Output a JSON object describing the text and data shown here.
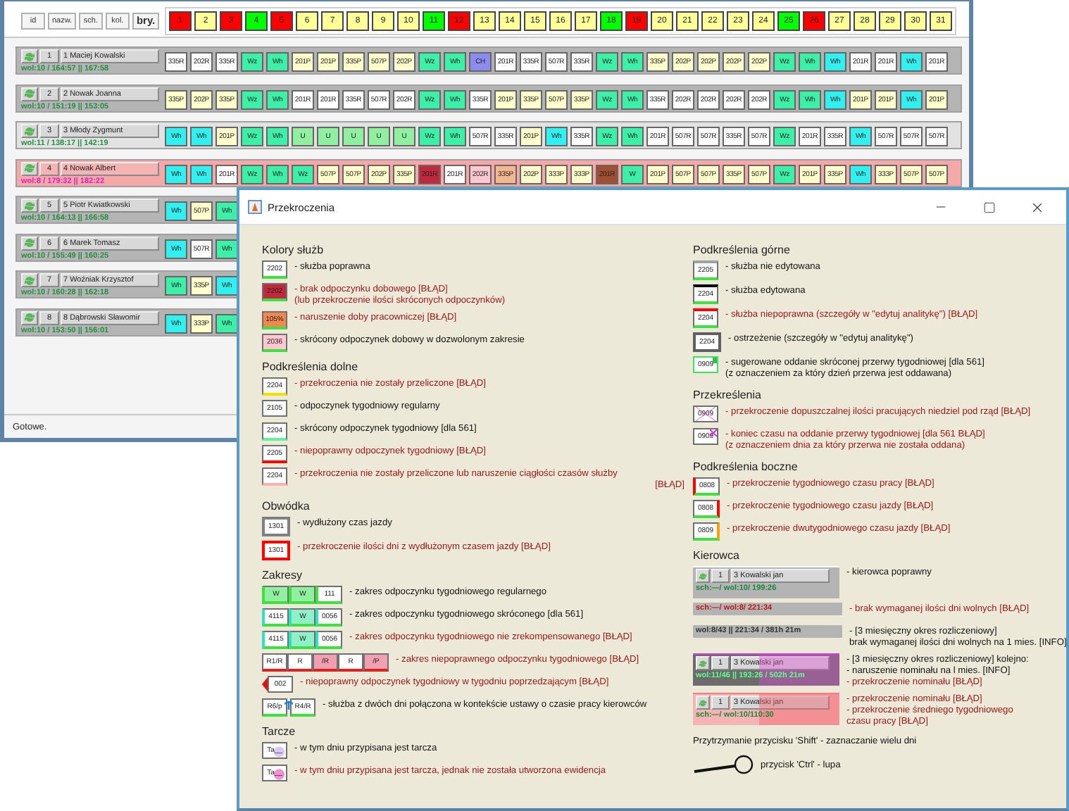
{
  "main_window": {
    "sort_buttons": [
      "id",
      "nazw.",
      "sch.",
      "kol.",
      "bry."
    ],
    "days": [
      {
        "label": "1",
        "color": "#ff0000"
      },
      {
        "label": "2",
        "color": "#ffff99"
      },
      {
        "label": "3",
        "color": "#ff0000"
      },
      {
        "label": "4",
        "color": "#00ff00"
      },
      {
        "label": "5",
        "color": "#ff0000"
      },
      {
        "label": "6",
        "color": "#ffff99"
      },
      {
        "label": "7",
        "color": "#ffff99"
      },
      {
        "label": "8",
        "color": "#ffff99"
      },
      {
        "label": "9",
        "color": "#ffff99"
      },
      {
        "label": "10",
        "color": "#ffff99"
      },
      {
        "label": "11",
        "color": "#00ff00"
      },
      {
        "label": "12",
        "color": "#ff0000"
      },
      {
        "label": "13",
        "color": "#ffff99"
      },
      {
        "label": "14",
        "color": "#ffff99"
      },
      {
        "label": "15",
        "color": "#ffff99"
      },
      {
        "label": "16",
        "color": "#ffff99"
      },
      {
        "label": "17",
        "color": "#ffff99"
      },
      {
        "label": "18",
        "color": "#00ff00"
      },
      {
        "label": "19",
        "color": "#ff0000"
      },
      {
        "label": "20",
        "color": "#ffff99"
      },
      {
        "label": "21",
        "color": "#ffff99"
      },
      {
        "label": "22",
        "color": "#ffff99"
      },
      {
        "label": "23",
        "color": "#ffff99"
      },
      {
        "label": "24",
        "color": "#ffff99"
      },
      {
        "label": "25",
        "color": "#00ff00"
      },
      {
        "label": "26",
        "color": "#ff0000"
      },
      {
        "label": "27",
        "color": "#ffff99"
      },
      {
        "label": "28",
        "color": "#ffff99"
      },
      {
        "label": "29",
        "color": "#ffff99"
      },
      {
        "label": "30",
        "color": "#ffff99"
      },
      {
        "label": "31",
        "color": "#ffff99"
      }
    ],
    "rows": [
      {
        "kind": "normal",
        "number": "1",
        "name": "1 Maciej Kowalski",
        "stats": "wol:10 / 164:57 || 167:58",
        "cells": [
          {
            "code": "335R",
            "color": "#ffffff"
          },
          {
            "code": "202R",
            "color": "#ffffff"
          },
          {
            "code": "335R",
            "color": "#ffffff"
          },
          {
            "code": "Wz",
            "color": "#3cf0a8"
          },
          {
            "code": "Wh",
            "color": "#3cf0a8"
          },
          {
            "code": "201P",
            "color": "#ffffcc"
          },
          {
            "code": "201P",
            "color": "#ffffcc"
          },
          {
            "code": "335P",
            "color": "#ffffcc"
          },
          {
            "code": "507P",
            "color": "#ffffcc"
          },
          {
            "code": "202P",
            "color": "#ffffcc"
          },
          {
            "code": "Wz",
            "color": "#3cf0a8"
          },
          {
            "code": "Wh",
            "color": "#3cf0a8"
          },
          {
            "code": "CH",
            "color": "#8c8cf0"
          },
          {
            "code": "201R",
            "color": "#ffffff"
          },
          {
            "code": "335R",
            "color": "#ffffff"
          },
          {
            "code": "507R",
            "color": "#ffffff"
          },
          {
            "code": "335R",
            "color": "#ffffff"
          },
          {
            "code": "Wz",
            "color": "#3cf0a8"
          },
          {
            "code": "Wh",
            "color": "#3cf0a8"
          },
          {
            "code": "335P",
            "color": "#ffffcc"
          },
          {
            "code": "202P",
            "color": "#ffffcc"
          },
          {
            "code": "202P",
            "color": "#ffffcc"
          },
          {
            "code": "202P",
            "color": "#ffffcc"
          },
          {
            "code": "202P",
            "color": "#ffffcc"
          },
          {
            "code": "Wz",
            "color": "#3cf0a8"
          },
          {
            "code": "Wh",
            "color": "#3cf0a8"
          },
          {
            "code": "Wh",
            "color": "#30f0f0"
          },
          {
            "code": "201R",
            "color": "#ffffff"
          },
          {
            "code": "201R",
            "color": "#ffffff"
          },
          {
            "code": "Wh",
            "color": "#30f0f0"
          },
          {
            "code": "201R",
            "color": "#ffffff"
          }
        ]
      },
      {
        "kind": "normal",
        "number": "2",
        "name": "2 Nowak Joanna",
        "stats": "wol:10 / 151:19 || 153:05",
        "cells": [
          {
            "code": "335P",
            "color": "#ffffcc"
          },
          {
            "code": "202P",
            "color": "#ffffcc"
          },
          {
            "code": "335P",
            "color": "#ffffcc"
          },
          {
            "code": "Wz",
            "color": "#3cf0a8"
          },
          {
            "code": "Wh",
            "color": "#3cf0a8"
          },
          {
            "code": "201R",
            "color": "#ffffff"
          },
          {
            "code": "201R",
            "color": "#ffffff"
          },
          {
            "code": "335R",
            "color": "#ffffff"
          },
          {
            "code": "507R",
            "color": "#ffffff"
          },
          {
            "code": "202R",
            "color": "#ffffff"
          },
          {
            "code": "Wz",
            "color": "#3cf0a8"
          },
          {
            "code": "Wh",
            "color": "#3cf0a8"
          },
          {
            "code": "335R",
            "color": "#ffffff"
          },
          {
            "code": "201P",
            "color": "#ffffcc"
          },
          {
            "code": "335P",
            "color": "#ffffcc"
          },
          {
            "code": "507P",
            "color": "#ffffcc"
          },
          {
            "code": "335P",
            "color": "#ffffcc"
          },
          {
            "code": "Wz",
            "color": "#3cf0a8"
          },
          {
            "code": "Wh",
            "color": "#3cf0a8"
          },
          {
            "code": "335R",
            "color": "#ffffff"
          },
          {
            "code": "202R",
            "color": "#ffffff"
          },
          {
            "code": "202R",
            "color": "#ffffff"
          },
          {
            "code": "202R",
            "color": "#ffffff"
          },
          {
            "code": "202R",
            "color": "#ffffff"
          },
          {
            "code": "Wz",
            "color": "#3cf0a8"
          },
          {
            "code": "Wh",
            "color": "#3cf0a8"
          },
          {
            "code": "Wh",
            "color": "#30f0f0"
          },
          {
            "code": "201P",
            "color": "#ffffcc"
          },
          {
            "code": "201P",
            "color": "#ffffcc"
          },
          {
            "code": "Wh",
            "color": "#30f0f0"
          },
          {
            "code": "201P",
            "color": "#ffffcc"
          }
        ]
      },
      {
        "kind": "light",
        "number": "3",
        "name": "3 Młody Zygmunt",
        "stats": "wol:11 / 138:17 || 142:19",
        "cells": [
          {
            "code": "Wh",
            "color": "#30f0f0"
          },
          {
            "code": "Wh",
            "color": "#30f0f0"
          },
          {
            "code": "201P",
            "color": "#ffffcc"
          },
          {
            "code": "Wz",
            "color": "#3cf0a8"
          },
          {
            "code": "Wh",
            "color": "#3cf0a8"
          },
          {
            "code": "U",
            "color": "#90f0a0"
          },
          {
            "code": "U",
            "color": "#90f0a0"
          },
          {
            "code": "U",
            "color": "#90f0a0"
          },
          {
            "code": "U",
            "color": "#90f0a0"
          },
          {
            "code": "U",
            "color": "#90f0a0"
          },
          {
            "code": "Wz",
            "color": "#3cf0a8"
          },
          {
            "code": "Wh",
            "color": "#3cf0a8"
          },
          {
            "code": "507R",
            "color": "#ffffff"
          },
          {
            "code": "335R",
            "color": "#ffffff"
          },
          {
            "code": "201P",
            "color": "#ffffcc"
          },
          {
            "code": "Wh",
            "color": "#30f0f0"
          },
          {
            "code": "335R",
            "color": "#ffffff"
          },
          {
            "code": "Wz",
            "color": "#3cf0a8"
          },
          {
            "code": "Wh",
            "color": "#3cf0a8"
          },
          {
            "code": "201R",
            "color": "#ffffff"
          },
          {
            "code": "507R",
            "color": "#ffffff"
          },
          {
            "code": "507R",
            "color": "#ffffff"
          },
          {
            "code": "335R",
            "color": "#ffffff"
          },
          {
            "code": "507R",
            "color": "#ffffff"
          },
          {
            "code": "Wz",
            "color": "#3cf0a8"
          },
          {
            "code": "201R",
            "color": "#ffffff"
          },
          {
            "code": "335R",
            "color": "#ffffff"
          },
          {
            "code": "Wh",
            "color": "#30f0f0"
          },
          {
            "code": "507R",
            "color": "#ffffff"
          },
          {
            "code": "507R",
            "color": "#ffffff"
          },
          {
            "code": "507R",
            "color": "#ffffff"
          }
        ]
      },
      {
        "kind": "error",
        "number": "4",
        "name": "4 Nowak Albert",
        "stats": "wol:8 / 179:32 || 182:22",
        "cells": [
          {
            "code": "Wh",
            "color": "#30f0f0"
          },
          {
            "code": "Wh",
            "color": "#30f0f0"
          },
          {
            "code": "201R",
            "color": "#ffffff"
          },
          {
            "code": "Wz",
            "color": "#3cf0a8"
          },
          {
            "code": "Wh",
            "color": "#3cf0a8"
          },
          {
            "code": "Wz",
            "color": "#3cf0a8"
          },
          {
            "code": "507P",
            "color": "#ffffcc"
          },
          {
            "code": "507P",
            "color": "#ffffcc"
          },
          {
            "code": "202P",
            "color": "#ffffcc"
          },
          {
            "code": "335P",
            "color": "#ffffcc"
          },
          {
            "code": "201R",
            "color": "#c0283c"
          },
          {
            "code": "201R",
            "color": "#ffffff"
          },
          {
            "code": "202R",
            "color": "#ffc8d0"
          },
          {
            "code": "335P",
            "color": "#f4b890"
          },
          {
            "code": "202P",
            "color": "#ffffcc"
          },
          {
            "code": "333P",
            "color": "#ffffcc"
          },
          {
            "code": "333P",
            "color": "#ffffcc"
          },
          {
            "code": "201R",
            "color": "#a05030"
          },
          {
            "code": "W",
            "color": "#3cf0a8"
          },
          {
            "code": "201P",
            "color": "#ffffcc"
          },
          {
            "code": "507P",
            "color": "#ffffcc"
          },
          {
            "code": "507P",
            "color": "#ffffcc"
          },
          {
            "code": "335P",
            "color": "#ffffcc"
          },
          {
            "code": "507P",
            "color": "#ffffcc"
          },
          {
            "code": "Wz",
            "color": "#3cf0a8"
          },
          {
            "code": "201P",
            "color": "#ffffcc"
          },
          {
            "code": "335P",
            "color": "#ffffcc"
          },
          {
            "code": "Wh",
            "color": "#30f0f0"
          },
          {
            "code": "333P",
            "color": "#ffffcc"
          },
          {
            "code": "507P",
            "color": "#ffffcc"
          },
          {
            "code": "507P",
            "color": "#ffffcc"
          }
        ]
      },
      {
        "kind": "normal",
        "number": "5",
        "name": "5 Piotr Kwiatkowski",
        "stats": "wol:10 / 164:13 || 166:58",
        "cells": [
          {
            "code": "Wh",
            "color": "#30f0f0"
          },
          {
            "code": "507P",
            "color": "#ffffcc"
          },
          {
            "code": "Wh",
            "color": "#3cf0a8"
          }
        ]
      },
      {
        "kind": "normal",
        "number": "6",
        "name": "6 Marek Tomasz",
        "stats": "wol:10 / 155:49 || 160:25",
        "cells": [
          {
            "code": "Wh",
            "color": "#30f0f0"
          },
          {
            "code": "507R",
            "color": "#ffffff"
          },
          {
            "code": "Wh",
            "color": "#3cf0a8"
          }
        ]
      },
      {
        "kind": "normal",
        "number": "7",
        "name": "7 Woźniak Krzysztof",
        "stats": "wol:10 / 160:28 || 162:18",
        "cells": [
          {
            "code": "Wh",
            "color": "#3cf0a8"
          },
          {
            "code": "335P",
            "color": "#ffffcc"
          },
          {
            "code": "Wh",
            "color": "#30f0f0"
          }
        ]
      },
      {
        "kind": "normal",
        "number": "8",
        "name": "8 Dąbrowski Sławomir",
        "stats": "wol:10 / 153:50 || 156:01",
        "cells": [
          {
            "code": "Wh",
            "color": "#30f0f0"
          },
          {
            "code": "333P",
            "color": "#ffffcc"
          },
          {
            "code": "Wh",
            "color": "#3cf0a8"
          }
        ]
      }
    ],
    "status_bar": "Gotowe."
  },
  "dialog": {
    "title": "Przekroczenia",
    "columns": [
      [
        {
          "heading": "Kolory służb",
          "items": [
            {
              "sample": {
                "kind": "ok",
                "cells": [
                  {
                    "code": "2202",
                    "color": "#ffffff"
                  }
                ]
              },
              "lines": [
                {
                  "text": "- służba poprawna",
                  "error": false
                }
              ]
            },
            {
              "sample": {
                "kind": "ok",
                "cells": [
                  {
                    "code": "2202",
                    "color": "#c0283c"
                  }
                ]
              },
              "lines": [
                {
                  "text": "- brak odpoczynku dobowego [BŁĄD]",
                  "error": true
                },
                {
                  "text": "(lub przekroczenie ilości skróconych odpoczynków)",
                  "error": true
                }
              ]
            },
            {
              "sample": {
                "kind": "ok",
                "cells": [
                  {
                    "code": "105%",
                    "color": "#f08850"
                  }
                ]
              },
              "lines": [
                {
                  "text": "- naruszenie doby pracowniczej [BŁĄD]",
                  "error": true
                }
              ]
            },
            {
              "sample": {
                "kind": "ok",
                "cells": [
                  {
                    "code": "2036",
                    "color": "#ffc8d0"
                  }
                ]
              },
              "lines": [
                {
                  "text": "- skrócony odpoczynek dobowy w dozwolonym zakresie",
                  "error": false
                }
              ]
            }
          ]
        },
        {
          "heading": "Podkreślenia dolne",
          "items": [
            {
              "sample": {
                "kind": "under-yellow",
                "cells": [
                  {
                    "code": "2204",
                    "color": "#ffffff"
                  }
                ]
              },
              "lines": [
                {
                  "text": "- przekroczenia nie zostały przeliczone [BŁĄD]",
                  "error": true
                }
              ]
            },
            {
              "sample": {
                "kind": "under-none",
                "cells": [
                  {
                    "code": "2105",
                    "color": "#ffffff"
                  }
                ]
              },
              "lines": [
                {
                  "text": "- odpoczynek tygodniowy regularny",
                  "error": false
                }
              ]
            },
            {
              "sample": {
                "kind": "under-green",
                "cells": [
                  {
                    "code": "2204",
                    "color": "#ffffff"
                  }
                ]
              },
              "lines": [
                {
                  "text": "- skrócony odpoczynek tygodniowy [dla 561]",
                  "error": false
                }
              ]
            },
            {
              "sample": {
                "kind": "under-red",
                "cells": [
                  {
                    "code": "2205",
                    "color": "#ffffff"
                  }
                ]
              },
              "lines": [
                {
                  "text": "- niepoprawny odpoczynek tygodniowy [BŁĄD]",
                  "error": true
                }
              ]
            },
            {
              "sample": {
                "kind": "under-pink",
                "cells": [
                  {
                    "code": "2204",
                    "color": "#ffffff"
                  }
                ]
              },
              "lines": [
                {
                  "text": "- przekroczenia nie zostały przeliczone lub naruszenie ciągłości czasów służby",
                  "error": true
                },
                {
                  "text": "[BŁĄD]",
                  "error": true,
                  "align_right": true
                }
              ]
            }
          ]
        },
        {
          "heading": "Obwódka",
          "items": [
            {
              "sample": {
                "kind": "frame-gray",
                "cells": [
                  {
                    "code": "1301",
                    "color": "#ffffff"
                  }
                ]
              },
              "lines": [
                {
                  "text": "- wydłużony czas jazdy",
                  "error": false
                }
              ]
            },
            {
              "sample": {
                "kind": "frame-red",
                "cells": [
                  {
                    "code": "1301",
                    "color": "#ffffff"
                  }
                ]
              },
              "lines": [
                {
                  "text": "- przekroczenie ilości dni z wydłużonym czasem jazdy [BŁĄD]",
                  "error": true
                }
              ]
            }
          ]
        },
        {
          "heading": "Zakresy",
          "items": [
            {
              "sample": {
                "kind": "range",
                "cells": [
                  {
                    "code": "W",
                    "color": "#90f0a0"
                  },
                  {
                    "code": "W",
                    "color": "#90f0a0"
                  },
                  {
                    "code": "111",
                    "color": "#ffffff"
                  }
                ]
              },
              "lines": [
                {
                  "text": "- zakres odpoczynku tygodniowego regularnego",
                  "error": false
                }
              ]
            },
            {
              "sample": {
                "kind": "range-short",
                "cells": [
                  {
                    "code": "4115",
                    "color": "#ffffff"
                  },
                  {
                    "code": "W",
                    "color": "#90f0c8"
                  },
                  {
                    "code": "0056",
                    "color": "#ffffff"
                  }
                ]
              },
              "lines": [
                {
                  "text": "- zakres odpoczynku tygodniowego skróconego  [dla 561]",
                  "error": false
                }
              ]
            },
            {
              "sample": {
                "kind": "range-short",
                "cells": [
                  {
                    "code": "4115",
                    "color": "#ffffff"
                  },
                  {
                    "code": "W",
                    "color": "#90f0c8"
                  },
                  {
                    "code": "0056",
                    "color": "#ffffff"
                  }
                ]
              },
              "lines": [
                {
                  "text": "- zakres odpoczynku tygodniowego nie zrekompensowanego [BŁĄD]",
                  "error": true
                }
              ]
            },
            {
              "sample": {
                "kind": "range-bad",
                "cells": [
                  {
                    "code": "R1/R",
                    "color": "#ffffff"
                  },
                  {
                    "code": "R",
                    "color": "#ffffff"
                  },
                  {
                    "code": "/R",
                    "color": "#f0a0b0"
                  },
                  {
                    "code": "R",
                    "color": "#ffffff"
                  },
                  {
                    "code": "/P",
                    "color": "#f0a0b0"
                  }
                ]
              },
              "lines": [
                {
                  "text": "- zakres niepoprawnego odpoczynku tygodniowego [BŁĄD]",
                  "error": true
                }
              ]
            },
            {
              "sample": {
                "kind": "arrow",
                "cells": [
                  {
                    "code": "002",
                    "color": "#ffffff"
                  }
                ]
              },
              "lines": [
                {
                  "text": "- niepoprawny odpoczynek tygodniowy w tygodniu poprzedzającym [BŁĄD]",
                  "error": true
                }
              ]
            },
            {
              "sample": {
                "kind": "joined",
                "cells": [
                  {
                    "code": "R6/p",
                    "color": "#ffffff"
                  },
                  {
                    "code": "R4/R",
                    "color": "#ffffff"
                  }
                ]
              },
              "lines": [
                {
                  "text": "- służba z dwóch dni połączona w kontekście ustawy o czasie pracy kierowców",
                  "error": false
                }
              ]
            }
          ]
        },
        {
          "heading": "Tarcze",
          "items": [
            {
              "sample": {
                "kind": "disc",
                "cells": [
                  {
                    "code": "Ta__",
                    "color": "#ffffff"
                  }
                ]
              },
              "lines": [
                {
                  "text": "- w tym dniu przypisana jest tarcza",
                  "error": false
                }
              ]
            },
            {
              "sample": {
                "kind": "disc-pink",
                "cells": [
                  {
                    "code": "Ta__",
                    "color": "#ffffff"
                  }
                ]
              },
              "lines": [
                {
                  "text": "- w tym dniu przypisana jest tarcza, jednak nie została utworzona ewidencja",
                  "error": true
                }
              ]
            }
          ]
        }
      ],
      [
        {
          "heading": "Podkreślenia górne",
          "items": [
            {
              "sample": {
                "kind": "top-gray",
                "cells": [
                  {
                    "code": "2205",
                    "color": "#ffffff"
                  }
                ]
              },
              "lines": [
                {
                  "text": "- służba  nie edytowana",
                  "error": false
                }
              ]
            },
            {
              "sample": {
                "kind": "top-black",
                "cells": [
                  {
                    "code": "2204",
                    "color": "#ffffff"
                  }
                ]
              },
              "lines": [
                {
                  "text": "- służba edytowana",
                  "error": false
                }
              ]
            },
            {
              "sample": {
                "kind": "top-red",
                "cells": [
                  {
                    "code": "2204",
                    "color": "#ffffff"
                  }
                ]
              },
              "lines": [
                {
                  "text": "- służba niepoprawna (szczegóły w \"edytuj analitykę\") [BŁĄD]",
                  "error": true
                }
              ]
            },
            {
              "sample": {
                "kind": "frame-dark",
                "cells": [
                  {
                    "code": "2204",
                    "color": "#ffffff"
                  }
                ]
              },
              "lines": [
                {
                  "text": "- ostrzeżenie (szczegóły w \"edytuj analitykę\")",
                  "error": false
                }
              ]
            },
            {
              "sample": {
                "kind": "corner",
                "cells": [
                  {
                    "code": "0909",
                    "color": "#ffffff"
                  }
                ]
              },
              "lines": [
                {
                  "text": "- sugerowane oddanie skróconej przerwy tygodniowej  [dla 561]",
                  "error": false
                },
                {
                  "text": "(z oznaczeniem za który dzień przerwa jest oddawana)",
                  "error": false
                }
              ]
            }
          ]
        },
        {
          "heading": "Przekreślenia",
          "items": [
            {
              "sample": {
                "kind": "cross",
                "cells": [
                  {
                    "code": "0909",
                    "color": "#ffffff"
                  }
                ]
              },
              "lines": [
                {
                  "text": "- przekroczenie dopuszczalnej ilości pracujących niedziel pod rząd [BŁĄD]",
                  "error": true
                }
              ]
            },
            {
              "sample": {
                "kind": "cross-small",
                "cells": [
                  {
                    "code": "0909",
                    "color": "#ffffff"
                  }
                ]
              },
              "lines": [
                {
                  "text": "- koniec czasu na oddanie przerwy tygodniowej [dla 561 BŁĄD]",
                  "error": true
                },
                {
                  "text": "(z oznaczeniem dnia za który przerwa nie została oddana)",
                  "error": true
                }
              ]
            }
          ]
        },
        {
          "heading": "Podkreślenia boczne",
          "items": [
            {
              "sample": {
                "kind": "side-left-red",
                "cells": [
                  {
                    "code": "0808",
                    "color": "#ffffff"
                  }
                ]
              },
              "lines": [
                {
                  "text": "- przekroczenie tygodniowego czasu pracy [BŁĄD]",
                  "error": true
                }
              ]
            },
            {
              "sample": {
                "kind": "side-right-red",
                "cells": [
                  {
                    "code": "0808",
                    "color": "#ffffff"
                  }
                ]
              },
              "lines": [
                {
                  "text": "- przekroczenie tygodniowego czasu jazdy [BŁĄD]",
                  "error": true
                }
              ]
            },
            {
              "sample": {
                "kind": "side-right-orange",
                "cells": [
                  {
                    "code": "0809",
                    "color": "#ffffff"
                  }
                ]
              },
              "lines": [
                {
                  "text": "- przekroczenie dwutygodniowego czasu jazdy [BŁĄD]",
                  "error": true
                }
              ]
            }
          ]
        },
        {
          "heading": "Kierowca",
          "items": [
            {
              "sample": {
                "kind": "driver-ok",
                "number": "1",
                "name": "3 Kowalski jan",
                "stats": "sch:—/ wol:10/ 199:26"
              },
              "lines": [
                {
                  "text": "- kierowca poprawny",
                  "error": false
                }
              ]
            },
            {
              "sample": {
                "kind": "bar-error",
                "stats": "sch:—/ wol:8/ 221:34"
              },
              "lines": [
                {
                  "text": "- brak wymaganej ilości dni wolnych [BŁĄD]",
                  "error": true
                }
              ]
            },
            {
              "sample": {
                "kind": "bar-info",
                "stats": "wol:8/43 || 221:34 / 381h 21m"
              },
              "lines": [
                {
                  "text": "- [3 miesięczny okres rozliczeniowy]",
                  "error": false
                },
                {
                  "text": "brak wymaganej ilości dni wolnych na 1 mies. [INFO]",
                  "error": false
                }
              ]
            },
            {
              "sample": {
                "kind": "driver-range",
                "number": "1",
                "name": "3 Kowalski jan",
                "stats": "wol:11/46 || 193:26 / 502h 21m"
              },
              "lines": [
                {
                  "text": "- [3 miesięczny okres rozliczeniowy] kolejno:",
                  "error": false
                },
                {
                  "text": "- naruszenie nominału na l mies. [INFO]",
                  "error": false
                },
                {
                  "text": "- przekroczenie nominału [BŁĄD]",
                  "error": true
                }
              ]
            },
            {
              "sample": {
                "kind": "driver-error",
                "number": "1",
                "name": "3 Kowalski jan",
                "stats": "sch:—/ wol:10/110:30"
              },
              "lines": [
                {
                  "text": "- przekroczenie nominału [BŁĄD]",
                  "error": true
                },
                {
                  "text": "- przekroczenie średniego tygodniowego",
                  "error": true
                },
                {
                  "text": "czasu pracy [BŁĄD]",
                  "error": true
                }
              ]
            }
          ]
        }
      ]
    ],
    "hints": [
      {
        "kind": "text",
        "text": "Przytrzymanie przycisku 'Shift' - zaznaczanie wielu dni"
      },
      {
        "kind": "magnifier",
        "text": "przycisk 'Ctrl' - lupa"
      }
    ]
  }
}
